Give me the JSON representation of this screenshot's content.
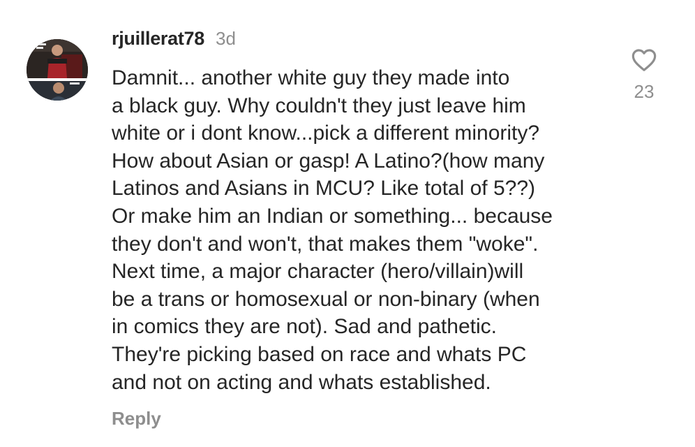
{
  "comment": {
    "username": "rjuillerat78",
    "timestamp": "3d",
    "body_lines": [
      "Damnit... another white guy they made into",
      "a black guy. Why couldn't they just leave him",
      "white or i dont know...pick a different minority?",
      "How about Asian or gasp! A Latino?(how many",
      "Latinos and Asians in MCU? Like total of 5??)",
      "Or make him an Indian or something... because",
      "they don't and won't, that makes them \"woke\".",
      "Next time, a major character (hero/villain)will",
      "be a trans or homosexual or non-binary (when",
      "in comics they are not). Sad and pathetic.",
      "They're picking based on race and whats PC",
      "and not on acting and whats established."
    ],
    "reply_label": "Reply",
    "like_icon": "heart-outline-icon",
    "like_count": "23"
  },
  "colors": {
    "text": "#262626",
    "secondary": "#8e8e8e",
    "background": "#ffffff"
  }
}
